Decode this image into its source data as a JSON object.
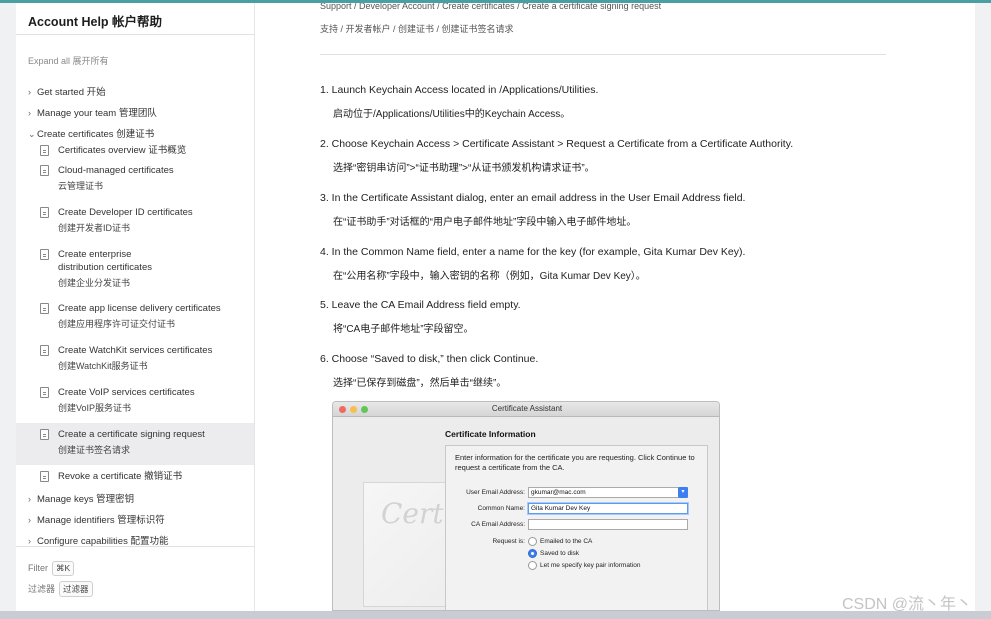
{
  "sidebar": {
    "title": "Account Help 帐户帮助",
    "expand_all": "Expand all 展开所有",
    "sections": [
      {
        "label": "Get started 开始"
      },
      {
        "label": "Manage your team 管理团队"
      },
      {
        "label": "Create certificates 创建证书"
      }
    ],
    "sub_items": [
      {
        "en": "Certificates overview 证书概览",
        "zh": ""
      },
      {
        "en": "Cloud-managed certificates",
        "zh": "云管理证书"
      },
      {
        "en": "Create Developer ID certificates",
        "zh": "创建开发者ID证书"
      },
      {
        "en": "Create enterprise distribution certificates",
        "zh": "创建企业分发证书"
      },
      {
        "en": "Create app license delivery certificates",
        "zh": "创建应用程序许可证交付证书"
      },
      {
        "en": "Create WatchKit services certificates",
        "zh": "创建WatchKit服务证书"
      },
      {
        "en": "Create VoIP services certificates",
        "zh": "创建VoIP服务证书"
      },
      {
        "en": "Create a certificate signing request",
        "zh": "创建证书签名请求"
      },
      {
        "en": "Revoke a certificate 撤销证书",
        "zh": ""
      }
    ],
    "sections_after": [
      {
        "label": "Manage keys 管理密钥"
      },
      {
        "label": "Manage identifiers 管理标识符"
      },
      {
        "label": "Configure capabilities 配置功能"
      }
    ],
    "filter_label": "Filter",
    "filter_kbd": "⌘K",
    "filter_zh_label": "过滤器",
    "filter_zh_btn": "过滤器"
  },
  "breadcrumb": {
    "en": "Support  /  Developer Account  /  Create certificates  /  Create a certificate signing request",
    "zh": "支持 / 开发者帐户 / 创建证书 / 创建证书签名请求"
  },
  "steps": [
    {
      "en": "1. Launch Keychain Access located in /Applications/Utilities.",
      "zh": "启动位于/Applications/Utilities中的Keychain Access。"
    },
    {
      "en": "2. Choose Keychain Access > Certificate Assistant > Request a Certificate from a Certificate Authority.",
      "zh": "选择“密钥串访问”>“证书助理”>“从证书颁发机构请求证书”。"
    },
    {
      "en": "3. In the Certificate Assistant dialog, enter an email address in the User Email Address field.",
      "zh": "在“证书助手”对话框的“用户电子邮件地址”字段中输入电子邮件地址。"
    },
    {
      "en": "4. In the Common Name field, enter a name for the key (for example, Gita Kumar Dev Key).",
      "zh": "在“公用名称”字段中，输入密钥的名称（例如，Gita Kumar Dev Key）。"
    },
    {
      "en": "5. Leave the CA Email Address field empty.",
      "zh": "将“CA电子邮件地址”字段留空。"
    },
    {
      "en": "6. Choose “Saved to disk,” then click Continue.",
      "zh": "选择“已保存到磁盘”，然后单击“继续”。"
    }
  ],
  "dialog": {
    "title": "Certificate Assistant",
    "heading": "Certificate Information",
    "info": "Enter information for the certificate you are requesting. Click Continue to request a certificate from the CA.",
    "user_email_label": "User Email Address:",
    "user_email_value": "gkumar@mac.com",
    "common_name_label": "Common Name:",
    "common_name_value": "Gita Kumar Dev Key",
    "ca_email_label": "CA Email Address:",
    "ca_email_value": "",
    "request_label": "Request is:",
    "options": [
      "Emailed to the CA",
      "Saved to disk",
      "Let me specify key pair information"
    ],
    "selected_option": "Saved to disk",
    "cert_script": "Certif"
  },
  "watermark": "CSDN @流丶年丶",
  "colors": {
    "accent": "#4a9fa2",
    "active_bg": "#ececef",
    "traffic_red": "#ee6a5f",
    "traffic_yellow": "#f5bf4f",
    "traffic_green": "#62c554",
    "focus_blue": "#3d7ef0"
  }
}
